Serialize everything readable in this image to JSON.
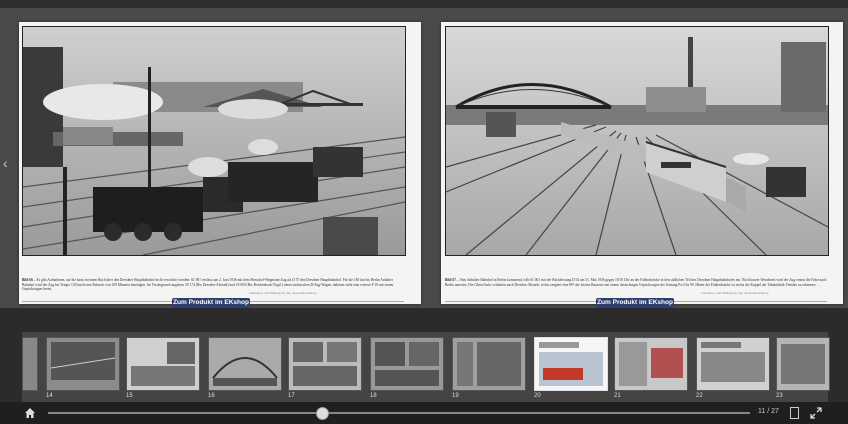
{
  "viewer": {
    "left_page": {
      "caption_label": "Bild 66 –",
      "caption": "Es gibt Aufnahmen, auf die kann in einem Buch über den Dresdner Hauptbahnhof nicht verzichtet werden: 61 001 verlässt am 2. Juni 1936 mit dem Henschel-Wegmann-Zug als D 57 den Dresdner Hauptbahnhof. Für die 180 km bis Berlin Anhalter Bahnhof wird der Zug bei Tempo 130 km/h eine Fahrzeit von 100 Minuten benötigen. Im Vordergrund rangieren 39 174 (Bw Dresden-Altstadt) und 18 009 (Bw Reichenbach/Vogtl.) einen sächsischen D-Zug-Wagen, dahinter steht eine weitere P 10 mit einem Gepäckwagen bereit.",
      "credit": "Aufnahme: Carl Bellingrodt, Slg. Eisenbahnstiftung",
      "page_label": "Seite 44"
    },
    "right_page": {
      "caption_label": "Bild 67 –",
      "caption": "Vom Anhalter Bahnhof in Berlin kommend, rollt 61 001 mit der Rückleistung D 54 am 31. Mai 1936 gegen 18.50 Uhr an der Falkenbrücke in den südlichen Teil des Dresdner Hauptbahnhofes ein. Nach kurzer Wendezeit wird der Zug erneut die Fahrt nach Berlin antreten. Die Gleise links verlaufen nach Dresden-Altstadt, rechts rangiert eine 89⁰ der letzten Bauserie mit einem dreiachsigen Gepäckwagen der Gattung Pw3 Sa 99. Hinter der Falkenbrücke ist rechts die Kuppel der Tabakfabrik Yenidze zu erkennen …",
      "credit": "Aufnahme: Carl Bellingrodt, Slg. Eisenbahnstiftung",
      "page_label": "Seite 45"
    },
    "shop_button_label": "Zum Produkt im EKshop",
    "prev_arrow": "‹",
    "next_arrow": "›"
  },
  "thumbnails": [
    {
      "num": "14"
    },
    {
      "num": "15"
    },
    {
      "num": "16"
    },
    {
      "num": "17"
    },
    {
      "num": "18"
    },
    {
      "num": "19"
    },
    {
      "num": "20"
    },
    {
      "num": "21"
    },
    {
      "num": "22"
    },
    {
      "num": "23"
    }
  ],
  "controls": {
    "page_counter": "11 / 27",
    "slider_position": 0.39,
    "home_icon": "home-icon",
    "fullscreen_icon": "fullscreen-icon"
  },
  "colors": {
    "shop_button": "#2e3f6e",
    "background": "#3a3a3a",
    "thumb_bar": "#2b2b2b"
  }
}
